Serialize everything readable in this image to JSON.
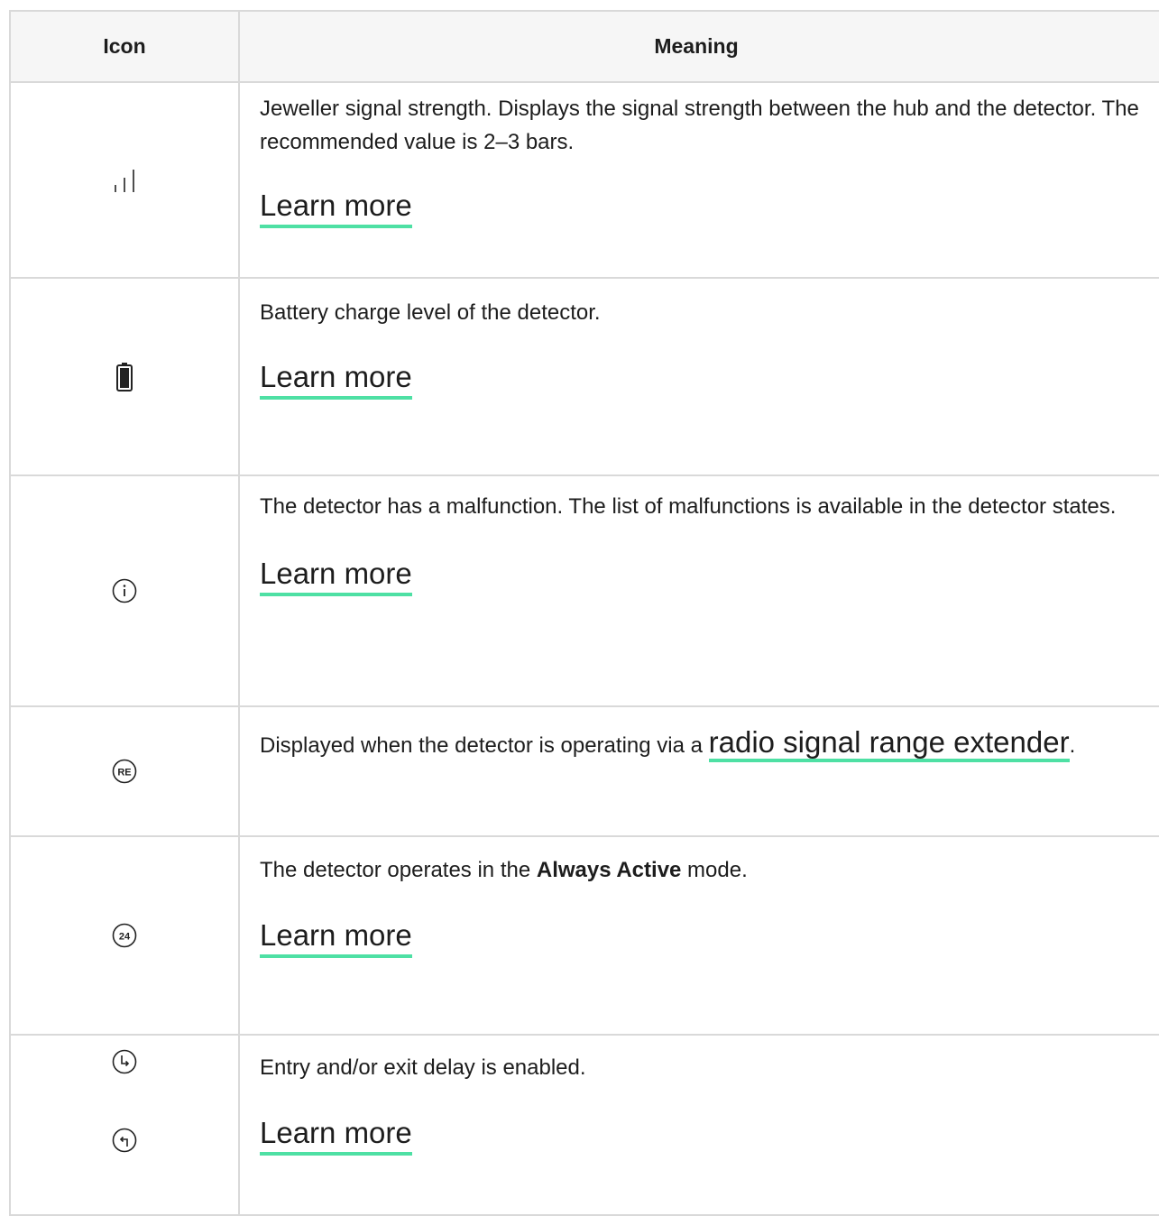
{
  "table": {
    "header": {
      "icon": "Icon",
      "meaning": "Meaning"
    },
    "rows": [
      {
        "icon": "signal-strength-icon",
        "description": "Jeweller signal strength. Displays the signal strength between the hub and the detector. The recommended value is 2–3 bars.",
        "link": "Learn more"
      },
      {
        "icon": "battery-icon",
        "description": "Battery charge level of the detector.",
        "link": "Learn more"
      },
      {
        "icon": "info-icon",
        "description": "The detector has a malfunction. The list of malfunctions is available in the detector states.",
        "link": "Learn more"
      },
      {
        "icon": "re-icon",
        "description_prefix": "Displayed when the detector is operating via a ",
        "link": "radio signal range extender",
        "description_suffix": "."
      },
      {
        "icon": "always-active-24-icon",
        "description_prefix": "The detector operates in the ",
        "description_bold": "Always Active",
        "description_suffix": " mode.",
        "link": "Learn more"
      },
      {
        "icons": [
          "entry-delay-icon",
          "exit-delay-icon"
        ],
        "description": "Entry and/or exit delay is enabled.",
        "link": "Learn more"
      }
    ]
  },
  "colors": {
    "link_underline": "#4ee0a4",
    "border": "#d9d9d9",
    "header_bg": "#f6f6f6"
  }
}
